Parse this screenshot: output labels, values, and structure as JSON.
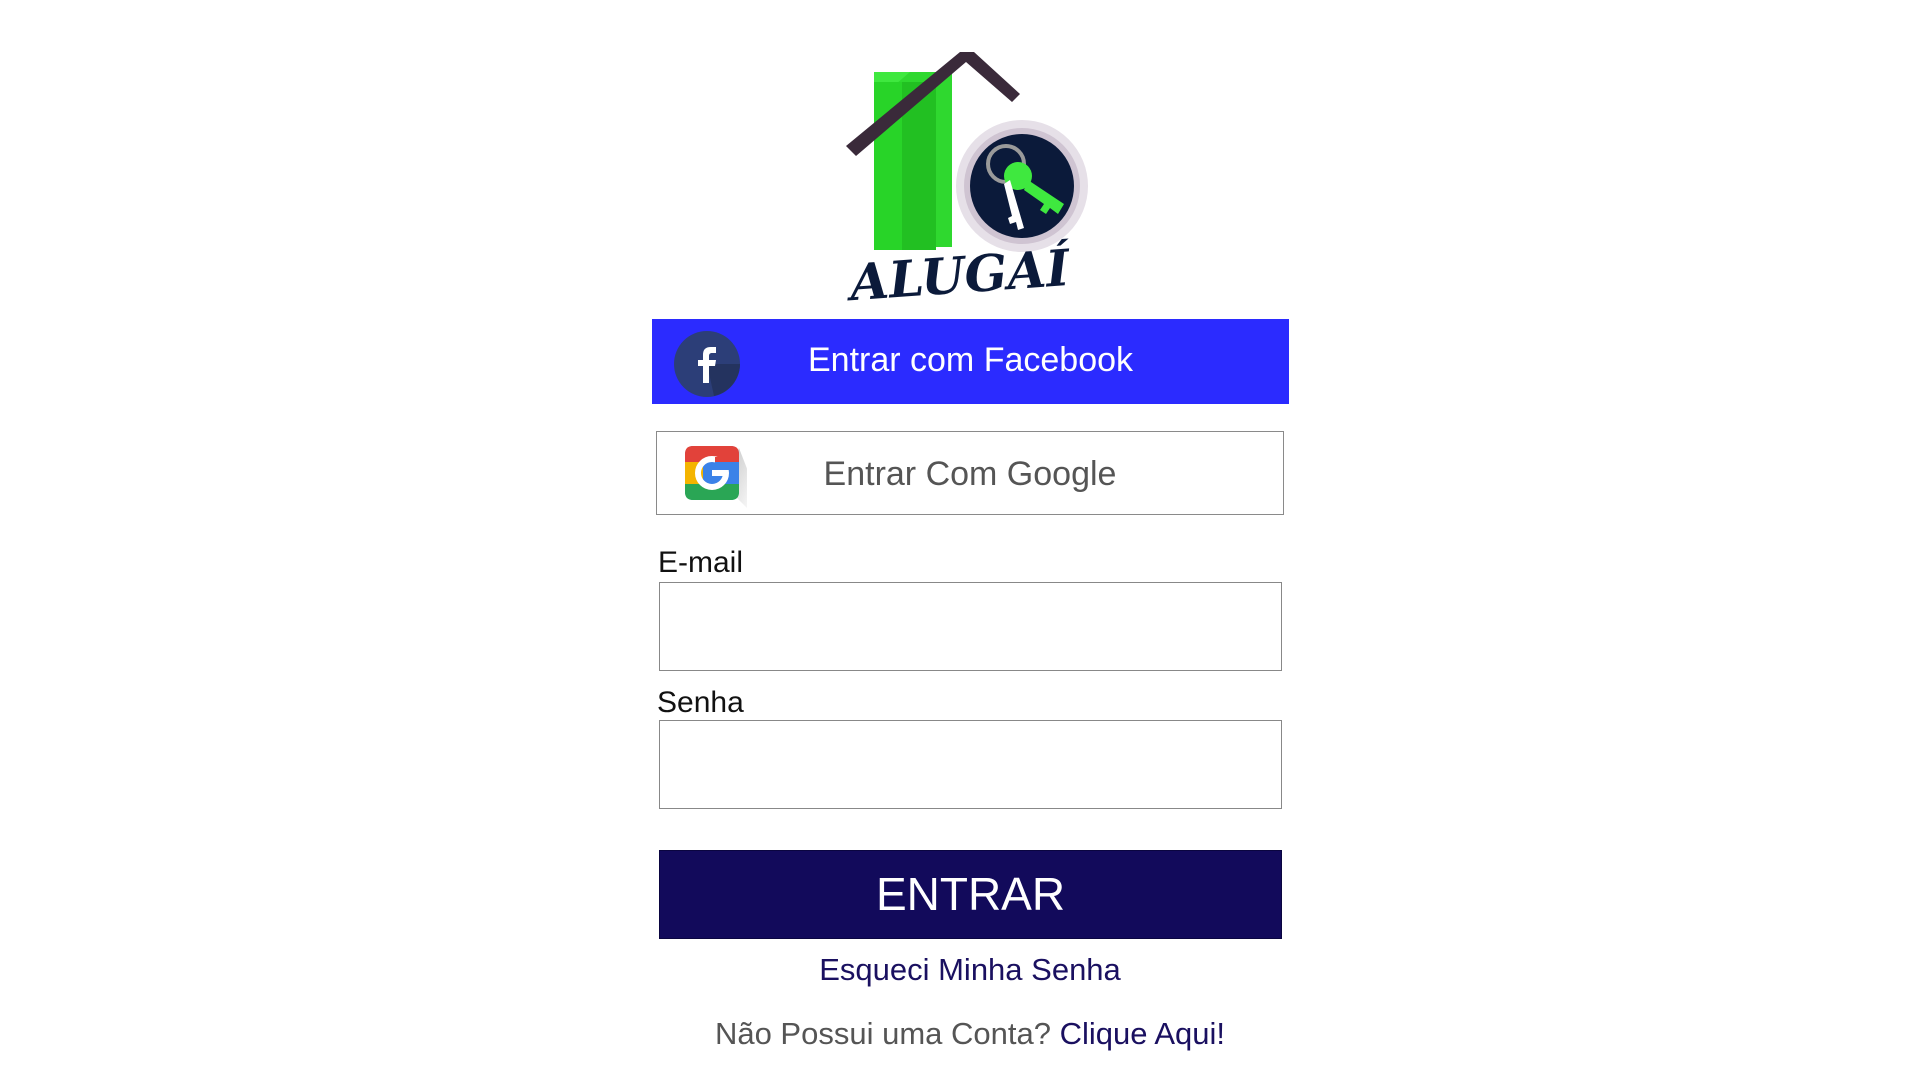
{
  "brand": {
    "logo_text": "ALUGAÍ",
    "logo_icon": "house-key-icon"
  },
  "social": {
    "facebook_label": "Entrar com Facebook",
    "facebook_icon": "facebook-icon",
    "facebook_color": "#2b2bff",
    "google_label": "Entrar Com Google",
    "google_icon": "google-icon"
  },
  "form": {
    "email_label": "E-mail",
    "email_value": "",
    "password_label": "Senha",
    "password_value": "",
    "submit_label": "ENTRAR",
    "submit_color": "#120a5b"
  },
  "links": {
    "forgot_password": "Esqueci Minha Senha",
    "no_account_text": "Não Possui uma Conta?",
    "signup_link": "Clique Aqui!"
  }
}
